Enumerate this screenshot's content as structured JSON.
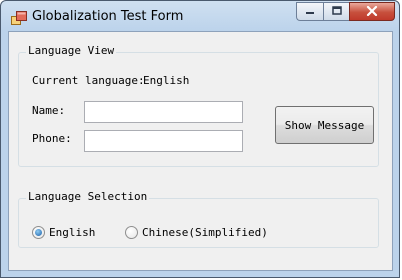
{
  "window": {
    "title": "Globalization Test Form"
  },
  "language_view": {
    "legend": "Language View",
    "current_language_label": "Current language:",
    "current_language_value": "English",
    "name_label": "Name:",
    "name_value": "",
    "phone_label": "Phone:",
    "phone_value": "",
    "show_message_label": "Show Message"
  },
  "language_selection": {
    "legend": "Language Selection",
    "options": [
      {
        "label": "English",
        "selected": true
      },
      {
        "label": "Chinese(Simplified)",
        "selected": false
      }
    ]
  },
  "icons": {
    "app": "window-app-icon",
    "minimize": "minimize-icon",
    "maximize": "maximize-icon",
    "close": "close-icon"
  }
}
